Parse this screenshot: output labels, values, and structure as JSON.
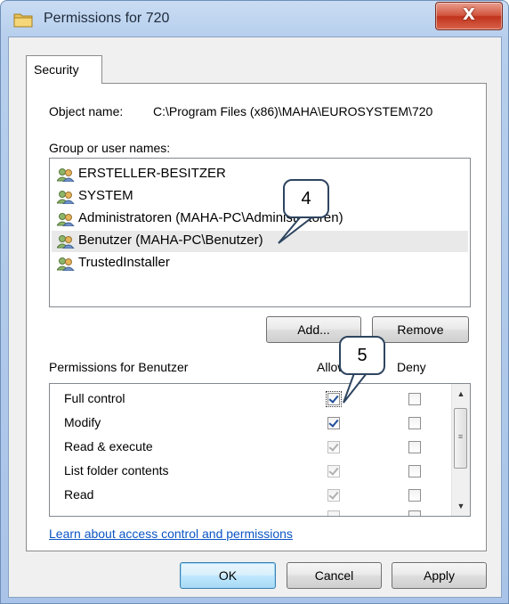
{
  "window": {
    "title": "Permissions for 720",
    "close_label": "X"
  },
  "tab": {
    "label": "Security"
  },
  "object": {
    "label": "Object name:",
    "value": "C:\\Program Files (x86)\\MAHA\\EUROSYSTEM\\720"
  },
  "groups": {
    "label": "Group or user names:",
    "items": [
      {
        "name": "ERSTELLER-BESITZER"
      },
      {
        "name": "SYSTEM"
      },
      {
        "name": "Administratoren (MAHA-PC\\Administratoren)"
      },
      {
        "name": "Benutzer (MAHA-PC\\Benutzer)"
      },
      {
        "name": "TrustedInstaller"
      }
    ],
    "selected_index": 3
  },
  "buttons": {
    "add": "Add...",
    "remove": "Remove",
    "ok": "OK",
    "cancel": "Cancel",
    "apply": "Apply"
  },
  "permissions": {
    "label": "Permissions for Benutzer",
    "allow_header": "Allow",
    "deny_header": "Deny",
    "rows": [
      {
        "name": "Full control",
        "allow": true,
        "allow_enabled": true,
        "deny": false
      },
      {
        "name": "Modify",
        "allow": true,
        "allow_enabled": true,
        "deny": false
      },
      {
        "name": "Read & execute",
        "allow": true,
        "allow_enabled": false,
        "deny": false
      },
      {
        "name": "List folder contents",
        "allow": true,
        "allow_enabled": false,
        "deny": false
      },
      {
        "name": "Read",
        "allow": true,
        "allow_enabled": false,
        "deny": false
      }
    ]
  },
  "link": {
    "text": "Learn about access control and permissions"
  },
  "callouts": {
    "first": "4",
    "second": "5"
  },
  "colors": {
    "title_gradient": "#b7cfed",
    "link": "#0b55c4",
    "close_button": "#c0331c"
  }
}
